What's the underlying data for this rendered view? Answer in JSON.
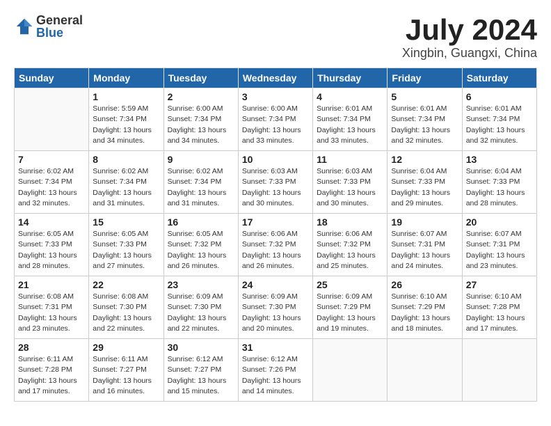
{
  "header": {
    "logo_general": "General",
    "logo_blue": "Blue",
    "title": "July 2024",
    "location": "Xingbin, Guangxi, China"
  },
  "weekdays": [
    "Sunday",
    "Monday",
    "Tuesday",
    "Wednesday",
    "Thursday",
    "Friday",
    "Saturday"
  ],
  "weeks": [
    [
      {
        "day": "",
        "info": ""
      },
      {
        "day": "1",
        "info": "Sunrise: 5:59 AM\nSunset: 7:34 PM\nDaylight: 13 hours\nand 34 minutes."
      },
      {
        "day": "2",
        "info": "Sunrise: 6:00 AM\nSunset: 7:34 PM\nDaylight: 13 hours\nand 34 minutes."
      },
      {
        "day": "3",
        "info": "Sunrise: 6:00 AM\nSunset: 7:34 PM\nDaylight: 13 hours\nand 33 minutes."
      },
      {
        "day": "4",
        "info": "Sunrise: 6:01 AM\nSunset: 7:34 PM\nDaylight: 13 hours\nand 33 minutes."
      },
      {
        "day": "5",
        "info": "Sunrise: 6:01 AM\nSunset: 7:34 PM\nDaylight: 13 hours\nand 32 minutes."
      },
      {
        "day": "6",
        "info": "Sunrise: 6:01 AM\nSunset: 7:34 PM\nDaylight: 13 hours\nand 32 minutes."
      }
    ],
    [
      {
        "day": "7",
        "info": "Sunrise: 6:02 AM\nSunset: 7:34 PM\nDaylight: 13 hours\nand 32 minutes."
      },
      {
        "day": "8",
        "info": "Sunrise: 6:02 AM\nSunset: 7:34 PM\nDaylight: 13 hours\nand 31 minutes."
      },
      {
        "day": "9",
        "info": "Sunrise: 6:02 AM\nSunset: 7:34 PM\nDaylight: 13 hours\nand 31 minutes."
      },
      {
        "day": "10",
        "info": "Sunrise: 6:03 AM\nSunset: 7:33 PM\nDaylight: 13 hours\nand 30 minutes."
      },
      {
        "day": "11",
        "info": "Sunrise: 6:03 AM\nSunset: 7:33 PM\nDaylight: 13 hours\nand 30 minutes."
      },
      {
        "day": "12",
        "info": "Sunrise: 6:04 AM\nSunset: 7:33 PM\nDaylight: 13 hours\nand 29 minutes."
      },
      {
        "day": "13",
        "info": "Sunrise: 6:04 AM\nSunset: 7:33 PM\nDaylight: 13 hours\nand 28 minutes."
      }
    ],
    [
      {
        "day": "14",
        "info": "Sunrise: 6:05 AM\nSunset: 7:33 PM\nDaylight: 13 hours\nand 28 minutes."
      },
      {
        "day": "15",
        "info": "Sunrise: 6:05 AM\nSunset: 7:33 PM\nDaylight: 13 hours\nand 27 minutes."
      },
      {
        "day": "16",
        "info": "Sunrise: 6:05 AM\nSunset: 7:32 PM\nDaylight: 13 hours\nand 26 minutes."
      },
      {
        "day": "17",
        "info": "Sunrise: 6:06 AM\nSunset: 7:32 PM\nDaylight: 13 hours\nand 26 minutes."
      },
      {
        "day": "18",
        "info": "Sunrise: 6:06 AM\nSunset: 7:32 PM\nDaylight: 13 hours\nand 25 minutes."
      },
      {
        "day": "19",
        "info": "Sunrise: 6:07 AM\nSunset: 7:31 PM\nDaylight: 13 hours\nand 24 minutes."
      },
      {
        "day": "20",
        "info": "Sunrise: 6:07 AM\nSunset: 7:31 PM\nDaylight: 13 hours\nand 23 minutes."
      }
    ],
    [
      {
        "day": "21",
        "info": "Sunrise: 6:08 AM\nSunset: 7:31 PM\nDaylight: 13 hours\nand 23 minutes."
      },
      {
        "day": "22",
        "info": "Sunrise: 6:08 AM\nSunset: 7:30 PM\nDaylight: 13 hours\nand 22 minutes."
      },
      {
        "day": "23",
        "info": "Sunrise: 6:09 AM\nSunset: 7:30 PM\nDaylight: 13 hours\nand 22 minutes."
      },
      {
        "day": "24",
        "info": "Sunrise: 6:09 AM\nSunset: 7:30 PM\nDaylight: 13 hours\nand 20 minutes."
      },
      {
        "day": "25",
        "info": "Sunrise: 6:09 AM\nSunset: 7:29 PM\nDaylight: 13 hours\nand 19 minutes."
      },
      {
        "day": "26",
        "info": "Sunrise: 6:10 AM\nSunset: 7:29 PM\nDaylight: 13 hours\nand 18 minutes."
      },
      {
        "day": "27",
        "info": "Sunrise: 6:10 AM\nSunset: 7:28 PM\nDaylight: 13 hours\nand 17 minutes."
      }
    ],
    [
      {
        "day": "28",
        "info": "Sunrise: 6:11 AM\nSunset: 7:28 PM\nDaylight: 13 hours\nand 17 minutes."
      },
      {
        "day": "29",
        "info": "Sunrise: 6:11 AM\nSunset: 7:27 PM\nDaylight: 13 hours\nand 16 minutes."
      },
      {
        "day": "30",
        "info": "Sunrise: 6:12 AM\nSunset: 7:27 PM\nDaylight: 13 hours\nand 15 minutes."
      },
      {
        "day": "31",
        "info": "Sunrise: 6:12 AM\nSunset: 7:26 PM\nDaylight: 13 hours\nand 14 minutes."
      },
      {
        "day": "",
        "info": ""
      },
      {
        "day": "",
        "info": ""
      },
      {
        "day": "",
        "info": ""
      }
    ]
  ]
}
